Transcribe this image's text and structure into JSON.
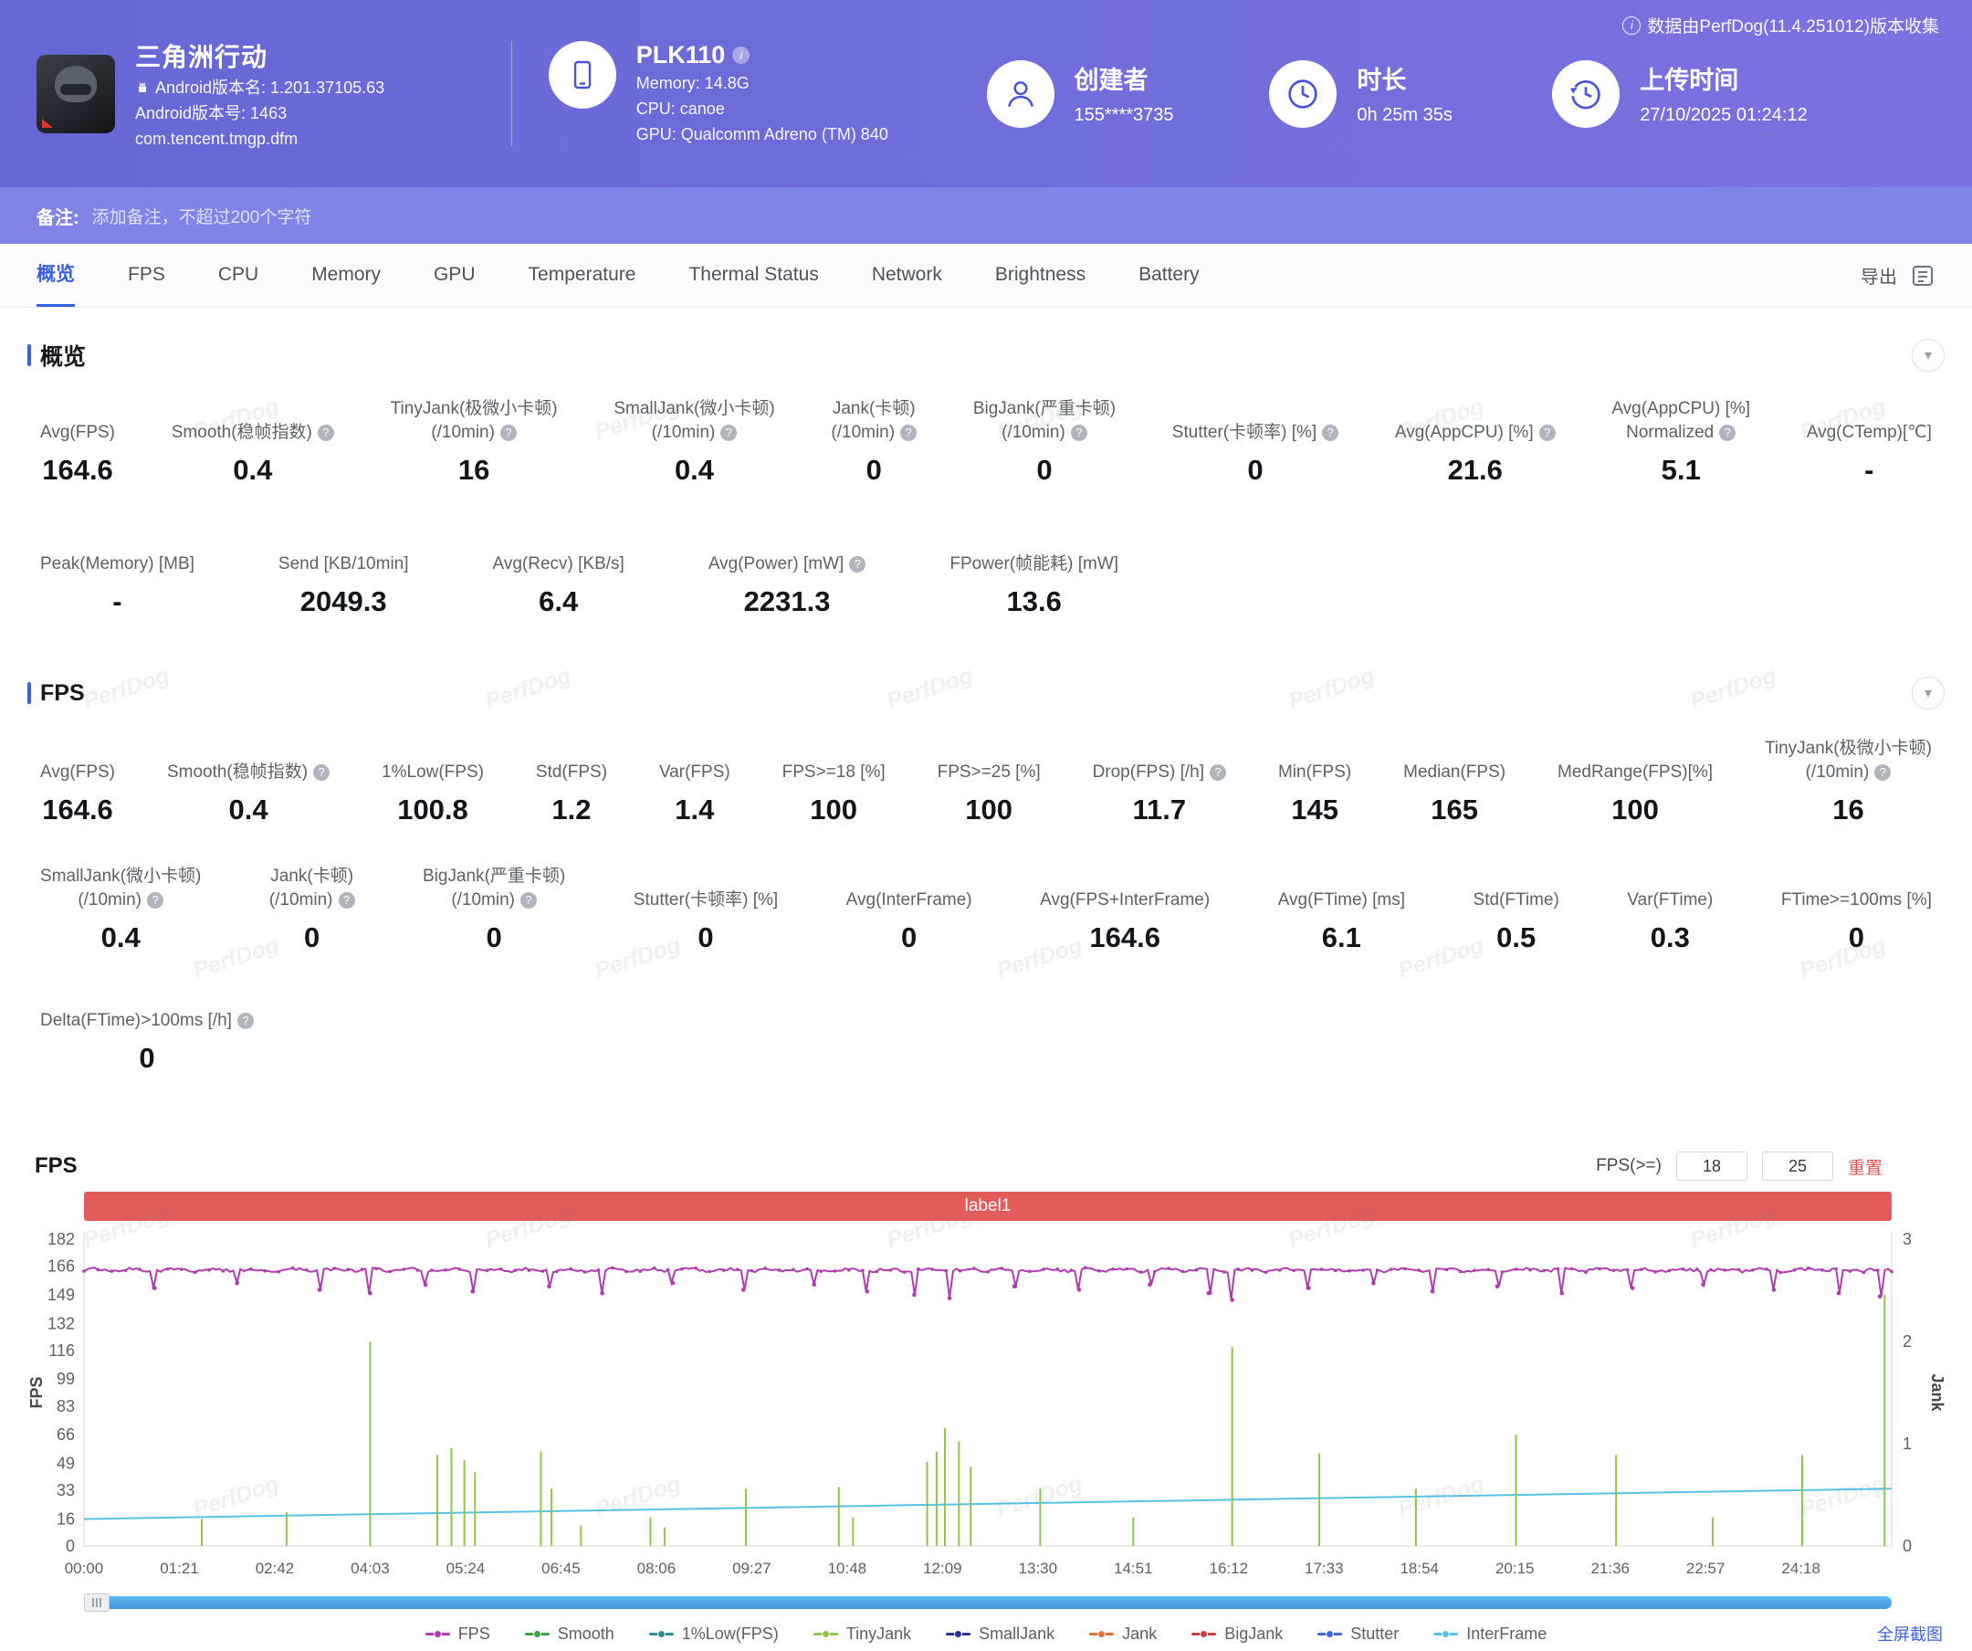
{
  "watermark": "PerfDog",
  "header": {
    "collector_note": "数据由PerfDog(11.4.251012)版本收集",
    "game": {
      "name": "三角洲行动",
      "version_name": "Android版本名: 1.201.37105.63",
      "version_code": "Android版本号: 1463",
      "package": "com.tencent.tmgp.dfm"
    },
    "device": {
      "model": "PLK110",
      "memory": "Memory: 14.8G",
      "cpu": "CPU: canoe",
      "gpu": "GPU: Qualcomm Adreno (TM) 840"
    },
    "creator": {
      "label": "创建者",
      "value": "155****3735"
    },
    "duration": {
      "label": "时长",
      "value": "0h 25m 35s"
    },
    "upload_time": {
      "label": "上传时间",
      "value": "27/10/2025 01:24:12"
    }
  },
  "note_bar": {
    "label": "备注:",
    "placeholder": "添加备注，不超过200个字符"
  },
  "tabs": {
    "items": [
      "概览",
      "FPS",
      "CPU",
      "Memory",
      "GPU",
      "Temperature",
      "Thermal Status",
      "Network",
      "Brightness",
      "Battery"
    ],
    "active_index": 0,
    "export_label": "导出"
  },
  "sections": {
    "overview": {
      "title": "概览",
      "rows": [
        [
          {
            "label": "Avg(FPS)",
            "value": "164.6"
          },
          {
            "label": "Smooth(稳帧指数)",
            "help": true,
            "value": "0.4"
          },
          {
            "label": "TinyJank(极微小卡顿)",
            "label2": "(/10min)",
            "help": true,
            "value": "16"
          },
          {
            "label": "SmallJank(微小卡顿)",
            "label2": "(/10min)",
            "help": true,
            "value": "0.4"
          },
          {
            "label": "Jank(卡顿)",
            "label2": "(/10min)",
            "help": true,
            "value": "0"
          },
          {
            "label": "BigJank(严重卡顿)",
            "label2": "(/10min)",
            "help": true,
            "value": "0"
          },
          {
            "label": "Stutter(卡顿率) [%]",
            "help": true,
            "value": "0"
          },
          {
            "label": "Avg(AppCPU) [%]",
            "help": true,
            "value": "21.6"
          },
          {
            "label": "Avg(AppCPU) [%]",
            "label2": "Normalized",
            "help": true,
            "value": "5.1"
          },
          {
            "label": "Avg(CTemp)[℃]",
            "value": "-"
          }
        ],
        [
          {
            "label": "Peak(Memory) [MB]",
            "value": "-"
          },
          {
            "label": "Send [KB/10min]",
            "value": "2049.3"
          },
          {
            "label": "Avg(Recv) [KB/s]",
            "value": "6.4"
          },
          {
            "label": "Avg(Power) [mW]",
            "help": true,
            "value": "2231.3"
          },
          {
            "label": "FPower(帧能耗) [mW]",
            "value": "13.6"
          }
        ]
      ]
    },
    "fps": {
      "title": "FPS",
      "rows": [
        [
          {
            "label": "Avg(FPS)",
            "value": "164.6"
          },
          {
            "label": "Smooth(稳帧指数)",
            "help": true,
            "value": "0.4"
          },
          {
            "label": "1%Low(FPS)",
            "value": "100.8"
          },
          {
            "label": "Std(FPS)",
            "value": "1.2"
          },
          {
            "label": "Var(FPS)",
            "value": "1.4"
          },
          {
            "label": "FPS>=18 [%]",
            "value": "100"
          },
          {
            "label": "FPS>=25 [%]",
            "value": "100"
          },
          {
            "label": "Drop(FPS) [/h]",
            "help": true,
            "value": "11.7"
          },
          {
            "label": "Min(FPS)",
            "value": "145"
          },
          {
            "label": "Median(FPS)",
            "value": "165"
          },
          {
            "label": "MedRange(FPS)[%]",
            "value": "100"
          },
          {
            "label": "TinyJank(极微小卡顿)",
            "label2": "(/10min)",
            "help": true,
            "value": "16"
          }
        ],
        [
          {
            "label": "SmallJank(微小卡顿)",
            "label2": "(/10min)",
            "help": true,
            "value": "0.4"
          },
          {
            "label": "Jank(卡顿)",
            "label2": "(/10min)",
            "help": true,
            "value": "0"
          },
          {
            "label": "BigJank(严重卡顿)",
            "label2": "(/10min)",
            "help": true,
            "value": "0"
          },
          {
            "label": "Stutter(卡顿率) [%]",
            "value": "0"
          },
          {
            "label": "Avg(InterFrame)",
            "value": "0"
          },
          {
            "label": "Avg(FPS+InterFrame)",
            "value": "164.6"
          },
          {
            "label": "Avg(FTime) [ms]",
            "value": "6.1"
          },
          {
            "label": "Std(FTime)",
            "value": "0.5"
          },
          {
            "label": "Var(FTime)",
            "value": "0.3"
          },
          {
            "label": "FTime>=100ms [%]",
            "value": "0"
          }
        ],
        [
          {
            "label": "Delta(FTime)>100ms [/h]",
            "help": true,
            "value": "0"
          }
        ]
      ]
    }
  },
  "chart": {
    "corner_label": "FPS",
    "controls": {
      "filter_label": "FPS(>=)",
      "input1": "18",
      "input2": "25",
      "reset_label": "重置"
    },
    "fullscreen_label": "全屏截图"
  },
  "chart_data": {
    "type": "line",
    "title": "label1",
    "x_axis": {
      "ticks": [
        "00:00",
        "01:21",
        "02:42",
        "04:03",
        "05:24",
        "06:45",
        "08:06",
        "09:27",
        "10:48",
        "12:09",
        "13:30",
        "14:51",
        "16:12",
        "17:33",
        "18:54",
        "20:15",
        "21:36",
        "22:57",
        "24:18"
      ],
      "tick_interval_sec": 81,
      "duration_sec": 1535
    },
    "y_left": {
      "label": "FPS",
      "ticks": [
        0,
        16,
        33,
        49,
        66,
        83,
        99,
        116,
        132,
        149,
        166,
        182
      ],
      "max": 182
    },
    "y_right": {
      "label": "Jank",
      "ticks": [
        0,
        1,
        2,
        3
      ],
      "max": 3
    },
    "legend": [
      {
        "name": "FPS",
        "color": "#b13bb1"
      },
      {
        "name": "Smooth",
        "color": "#41a048"
      },
      {
        "name": "1%Low(FPS)",
        "color": "#2f8f8f"
      },
      {
        "name": "TinyJank",
        "color": "#8fc645"
      },
      {
        "name": "SmallJank",
        "color": "#27338f"
      },
      {
        "name": "Jank",
        "color": "#e4703a"
      },
      {
        "name": "BigJank",
        "color": "#cf3b45"
      },
      {
        "name": "Stutter",
        "color": "#3d66e0"
      },
      {
        "name": "InterFrame",
        "color": "#57c4e6"
      }
    ],
    "series": {
      "fps": {
        "baseline": 164.6,
        "dips": [
          [
            60,
            153
          ],
          [
            130,
            156
          ],
          [
            200,
            152
          ],
          [
            243,
            150
          ],
          [
            290,
            155
          ],
          [
            330,
            151
          ],
          [
            395,
            154
          ],
          [
            440,
            150
          ],
          [
            500,
            156
          ],
          [
            560,
            152
          ],
          [
            620,
            155
          ],
          [
            665,
            151
          ],
          [
            705,
            149
          ],
          [
            735,
            147
          ],
          [
            790,
            154
          ],
          [
            845,
            152
          ],
          [
            905,
            155
          ],
          [
            955,
            150
          ],
          [
            975,
            146
          ],
          [
            1040,
            153
          ],
          [
            1095,
            156
          ],
          [
            1145,
            151
          ],
          [
            1200,
            154
          ],
          [
            1255,
            150
          ],
          [
            1315,
            153
          ],
          [
            1375,
            155
          ],
          [
            1435,
            152
          ],
          [
            1490,
            150
          ],
          [
            1525,
            148
          ]
        ]
      },
      "tinyjank_spikes": [
        [
          100,
          16
        ],
        [
          172,
          20
        ],
        [
          243,
          121
        ],
        [
          300,
          54
        ],
        [
          312,
          58
        ],
        [
          323,
          51
        ],
        [
          332,
          44
        ],
        [
          388,
          56
        ],
        [
          397,
          34
        ],
        [
          422,
          12
        ],
        [
          481,
          17
        ],
        [
          493,
          11
        ],
        [
          562,
          34
        ],
        [
          641,
          35
        ],
        [
          653,
          17
        ],
        [
          716,
          50
        ],
        [
          724,
          56
        ],
        [
          731,
          70
        ],
        [
          743,
          62
        ],
        [
          753,
          47
        ],
        [
          812,
          34
        ],
        [
          891,
          17
        ],
        [
          975,
          118
        ],
        [
          1049,
          55
        ],
        [
          1131,
          34
        ],
        [
          1216,
          66
        ],
        [
          1301,
          54
        ],
        [
          1383,
          17
        ],
        [
          1459,
          54
        ],
        [
          1529,
          149
        ]
      ],
      "trend": {
        "start": 16,
        "end": 34
      }
    }
  }
}
